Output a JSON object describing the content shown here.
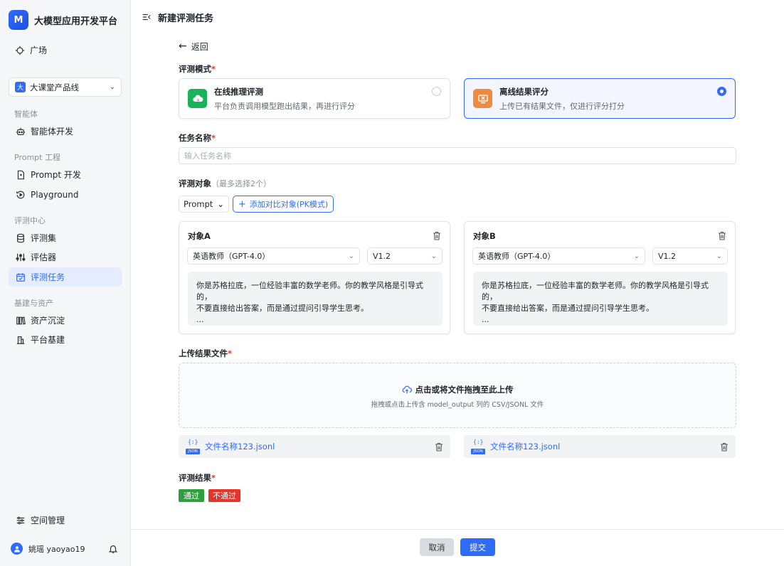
{
  "sidebar": {
    "brand": {
      "logo_text": "M",
      "title": "大模型应用开发平台"
    },
    "top_item": {
      "label": "广场",
      "icon": "compass-icon"
    },
    "product_line": {
      "badge": "大",
      "label": "大课堂产品线"
    },
    "groups": {
      "agent": "智能体",
      "prompt": "Prompt 工程",
      "eval": "评测中心",
      "base": "基建与资产"
    },
    "items": {
      "agent_dev": "智能体开发",
      "prompt_dev": "Prompt 开发",
      "playground": "Playground",
      "eval_set": "评测集",
      "evaluator": "评估器",
      "eval_task": "评测任务",
      "assets": "资产沉淀",
      "platform": "平台基建",
      "space": "空间管理"
    },
    "user": {
      "name": "姚瑶 yaoyao19"
    }
  },
  "header": {
    "title": "新建评测任务"
  },
  "form": {
    "back": "返回",
    "mode_label": "评测模式",
    "modes": [
      {
        "title": "在线推理评测",
        "desc": "平台负责调用模型跑出结果，再进行评分",
        "selected": false
      },
      {
        "title": "离线结果评分",
        "desc": "上传已有结果文件，仅进行评分打分",
        "selected": true
      }
    ],
    "task_name_label": "任务名称",
    "task_name_placeholder": "输入任务名称",
    "target_label": "评测对象",
    "target_hint": "（最多选择2个）",
    "target_type": "Prompt",
    "add_compare": "添加对比对象(PK模式)",
    "objects": [
      {
        "title": "对象A",
        "model": "英语教师（GPT-4.0）",
        "version": "V1.2",
        "content": "你是苏格拉底，一位经验丰富的数学老师。你的教学风格是引导式的，\n不要直接给出答案，而是通过提问引导学生思考。\n..."
      },
      {
        "title": "对象B",
        "model": "英语教师（GPT-4.0）",
        "version": "V1.2",
        "content": "你是苏格拉底，一位经验丰富的数学老师。你的教学风格是引导式的，\n不要直接给出答案，而是通过提问引导学生思考。\n..."
      }
    ],
    "upload_label": "上传结果文件",
    "upload_title": "点击或将文件拖拽至此上传",
    "upload_sub": "拖拽或点击上传含 model_output 列的 CSV/JSONL 文件",
    "files": [
      {
        "name": "文件名称123.jsonl",
        "icon_tag": "JSON",
        "icon_brackets": "{:}"
      },
      {
        "name": "文件名称123.jsonl",
        "icon_tag": "JSON",
        "icon_brackets": "{:}"
      }
    ],
    "result_label": "评测结果",
    "result_pass": "通过",
    "result_fail": "不通过",
    "required_mark": "*"
  },
  "actions": {
    "cancel": "取消",
    "submit": "提交"
  },
  "colors": {
    "accent": "#2f6bff",
    "pass": "#2e9e3e",
    "fail": "#e5352b"
  }
}
